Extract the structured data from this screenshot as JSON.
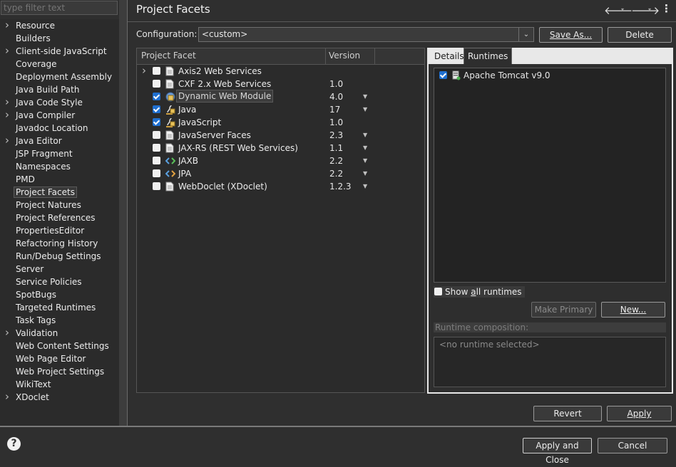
{
  "filter": {
    "placeholder": "type filter text"
  },
  "nav": {
    "items": [
      {
        "label": "Resource",
        "expandable": true
      },
      {
        "label": "Builders",
        "expandable": false
      },
      {
        "label": "Client-side JavaScript",
        "expandable": true
      },
      {
        "label": "Coverage",
        "expandable": false
      },
      {
        "label": "Deployment Assembly",
        "expandable": false
      },
      {
        "label": "Java Build Path",
        "expandable": false
      },
      {
        "label": "Java Code Style",
        "expandable": true
      },
      {
        "label": "Java Compiler",
        "expandable": true
      },
      {
        "label": "Javadoc Location",
        "expandable": false
      },
      {
        "label": "Java Editor",
        "expandable": true
      },
      {
        "label": "JSP Fragment",
        "expandable": false
      },
      {
        "label": "Namespaces",
        "expandable": false
      },
      {
        "label": "PMD",
        "expandable": false
      },
      {
        "label": "Project Facets",
        "expandable": false,
        "selected": true
      },
      {
        "label": "Project Natures",
        "expandable": false
      },
      {
        "label": "Project References",
        "expandable": false
      },
      {
        "label": "PropertiesEditor",
        "expandable": false
      },
      {
        "label": "Refactoring History",
        "expandable": false
      },
      {
        "label": "Run/Debug Settings",
        "expandable": false
      },
      {
        "label": "Server",
        "expandable": false
      },
      {
        "label": "Service Policies",
        "expandable": false
      },
      {
        "label": "SpotBugs",
        "expandable": false
      },
      {
        "label": "Targeted Runtimes",
        "expandable": false
      },
      {
        "label": "Task Tags",
        "expandable": false
      },
      {
        "label": "Validation",
        "expandable": true
      },
      {
        "label": "Web Content Settings",
        "expandable": false
      },
      {
        "label": "Web Page Editor",
        "expandable": false
      },
      {
        "label": "Web Project Settings",
        "expandable": false
      },
      {
        "label": "WikiText",
        "expandable": false
      },
      {
        "label": "XDoclet",
        "expandable": true
      }
    ]
  },
  "header": {
    "title": "Project Facets"
  },
  "configuration": {
    "label": "Configuration:",
    "value": "<custom>",
    "save_as": "Save As...",
    "delete": "Delete"
  },
  "facets_table": {
    "col_facet": "Project Facet",
    "col_version": "Version",
    "rows": [
      {
        "name": "Axis2 Web Services",
        "version": "",
        "checked": false,
        "expandable": true,
        "icon": "document-icon",
        "dropdown": false
      },
      {
        "name": "CXF 2.x Web Services",
        "version": "1.0",
        "checked": false,
        "icon": "document-icon",
        "dropdown": false
      },
      {
        "name": "Dynamic Web Module",
        "version": "4.0",
        "checked": true,
        "icon": "web-module-icon",
        "dropdown": true,
        "highlighted": true
      },
      {
        "name": "Java",
        "version": "17",
        "checked": true,
        "icon": "java-icon",
        "dropdown": true
      },
      {
        "name": "JavaScript",
        "version": "1.0",
        "checked": true,
        "icon": "javascript-icon",
        "dropdown": false
      },
      {
        "name": "JavaServer Faces",
        "version": "2.3",
        "checked": false,
        "icon": "document-icon",
        "dropdown": true
      },
      {
        "name": "JAX-RS (REST Web Services)",
        "version": "1.1",
        "checked": false,
        "icon": "document-icon",
        "dropdown": true
      },
      {
        "name": "JAXB",
        "version": "2.2",
        "checked": false,
        "icon": "jaxb-icon",
        "dropdown": true
      },
      {
        "name": "JPA",
        "version": "2.2",
        "checked": false,
        "icon": "jpa-icon",
        "dropdown": true
      },
      {
        "name": "WebDoclet (XDoclet)",
        "version": "1.2.3",
        "checked": false,
        "icon": "document-icon",
        "dropdown": true
      }
    ]
  },
  "right_panel": {
    "tab_details": "Details",
    "tab_runtimes": "Runtimes",
    "runtimes": [
      {
        "name": "Apache Tomcat v9.0",
        "checked": true
      }
    ],
    "show_all_prefix": "Show ",
    "show_all_mnemonic": "a",
    "show_all_suffix": "ll runtimes",
    "make_primary": "Make Primary",
    "new": "New...",
    "composition_label": "Runtime composition:",
    "composition_empty": "<no runtime selected>"
  },
  "footer": {
    "revert": "Revert",
    "apply": "Apply",
    "apply_and_close": "Apply and Close",
    "cancel": "Cancel"
  }
}
